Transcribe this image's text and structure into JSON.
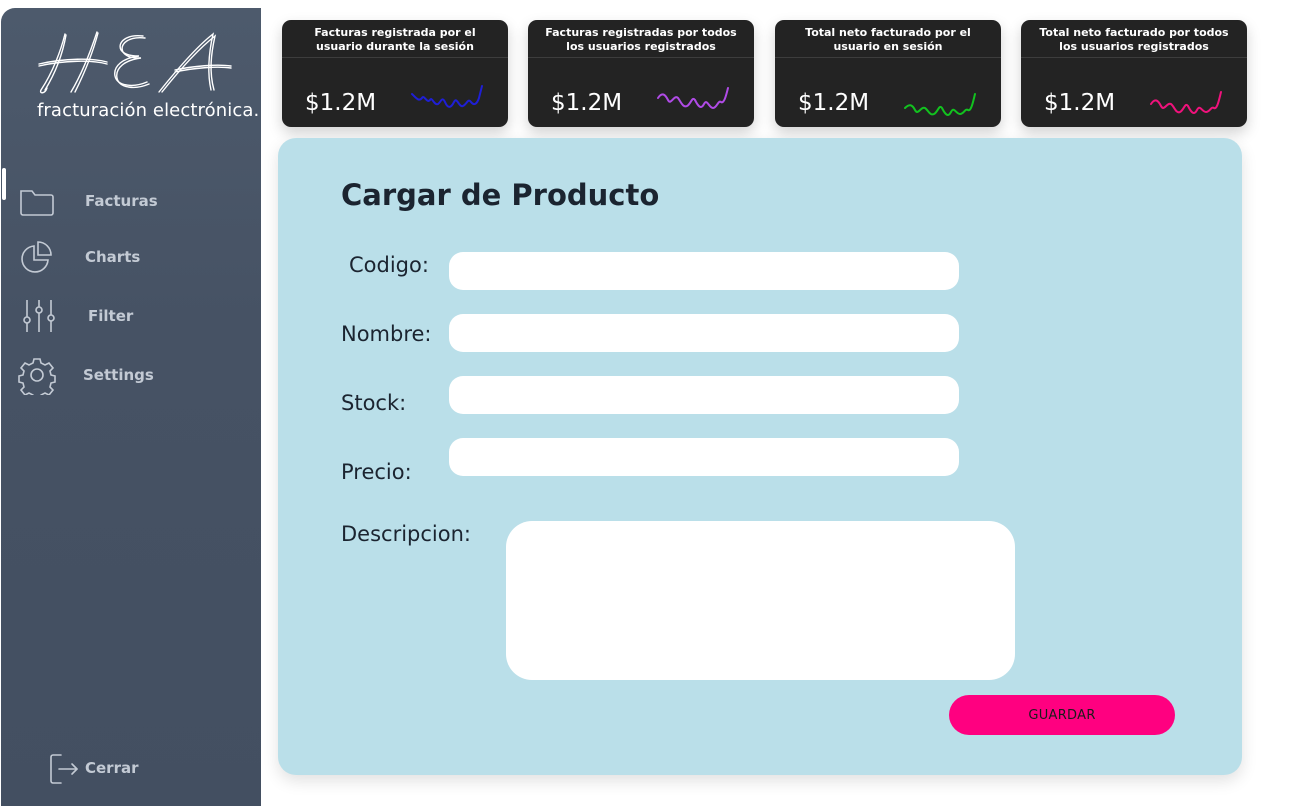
{
  "brand": {
    "logo_text": "HEA",
    "subtitle": "fracturación electrónica."
  },
  "sidebar": {
    "items": [
      {
        "label": "Facturas",
        "icon": "folder-icon"
      },
      {
        "label": "Charts",
        "icon": "pie-chart-icon"
      },
      {
        "label": "Filter",
        "icon": "sliders-icon"
      },
      {
        "label": "Settings",
        "icon": "gear-icon"
      }
    ],
    "logout": {
      "label": "Cerrar",
      "icon": "logout-icon"
    }
  },
  "kpis": [
    {
      "title": "Facturas registrada por el usuario durante la sesión",
      "value": "$1.2M",
      "spark_color": "#1f1fd6"
    },
    {
      "title": "Facturas registradas por todos los usuarios registrados",
      "value": "$1.2M",
      "spark_color": "#b04be6"
    },
    {
      "title": "Total neto facturado por el usuario en sesión",
      "value": "$1.2M",
      "spark_color": "#12c21f"
    },
    {
      "title": "Total neto facturado por todos los usuarios registrados",
      "value": "$1.2M",
      "spark_color": "#f0127c"
    }
  ],
  "form": {
    "title": "Cargar de Producto",
    "fields": {
      "codigo": {
        "label": "Codigo:",
        "value": ""
      },
      "nombre": {
        "label": "Nombre:",
        "value": ""
      },
      "stock": {
        "label": "Stock:",
        "value": ""
      },
      "precio": {
        "label": "Precio:",
        "value": ""
      },
      "descripcion": {
        "label": "Descripcion:",
        "value": ""
      }
    },
    "save_label": "GUARDAR"
  },
  "colors": {
    "sidebar": "#465264",
    "panel": "#badfe9",
    "card": "#232323",
    "accent": "#ff0080"
  }
}
